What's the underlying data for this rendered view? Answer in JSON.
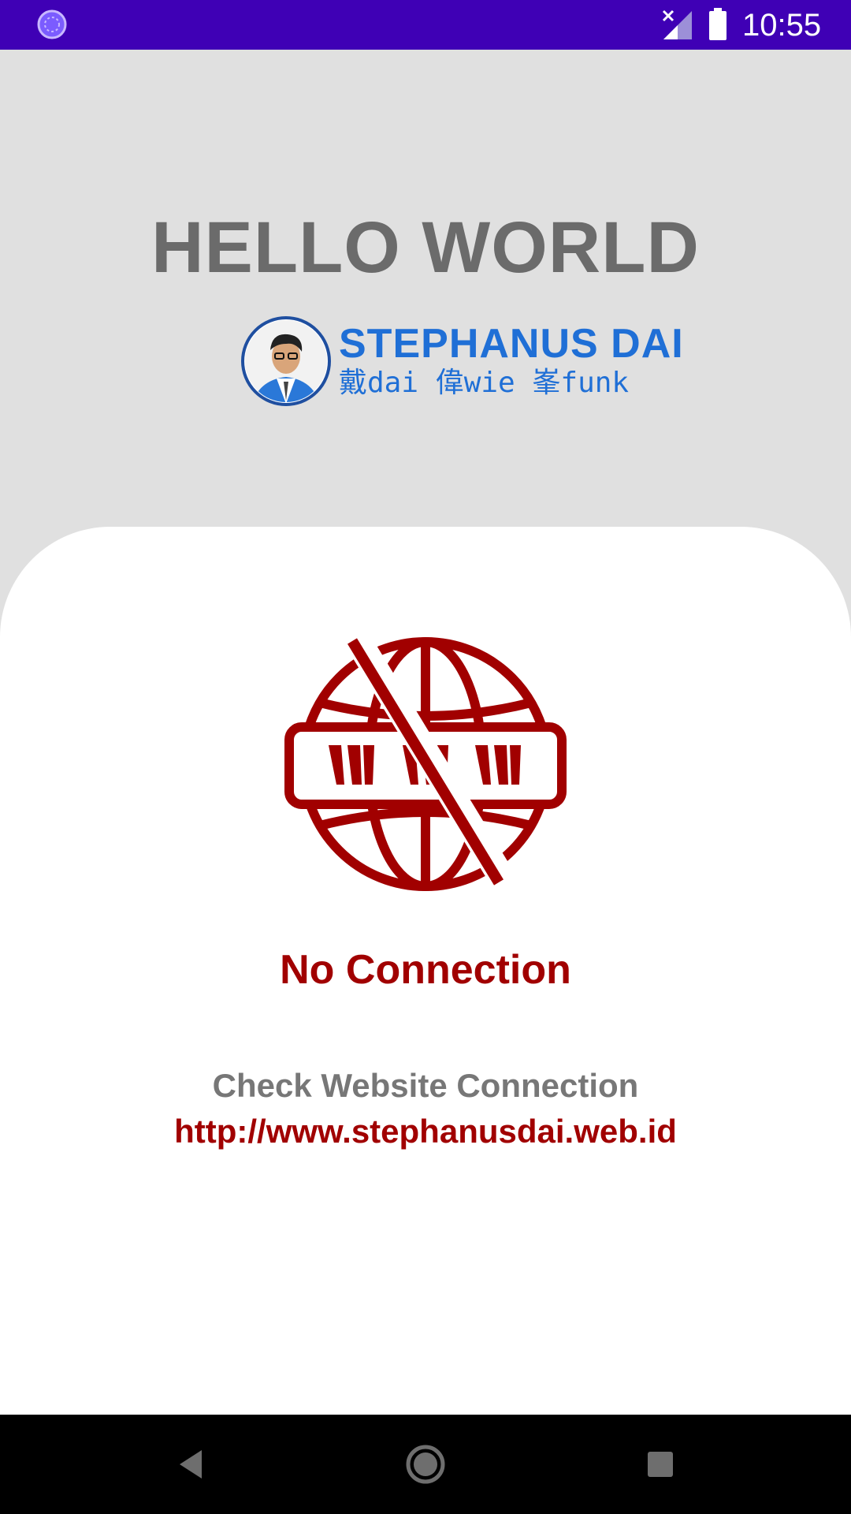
{
  "status_bar": {
    "time": "10:55",
    "icons": [
      "app-notification-icon",
      "signal-off-icon",
      "battery-icon"
    ],
    "background": "#3f00b5"
  },
  "header": {
    "title": "HELLO WORLD",
    "logo": {
      "name": "STEPHANUS DAI",
      "subtitle": "戴dai 偉wie 峯funk",
      "color": "#1f6fd6"
    }
  },
  "card": {
    "icon": "no-www-globe-icon",
    "heading": "No Connection",
    "message": "Check Website Connection",
    "url": "http://www.stephanusdai.web.id",
    "accent": "#a10000"
  },
  "nav_bar": {
    "buttons": [
      "back-icon",
      "home-icon",
      "recents-icon"
    ]
  }
}
